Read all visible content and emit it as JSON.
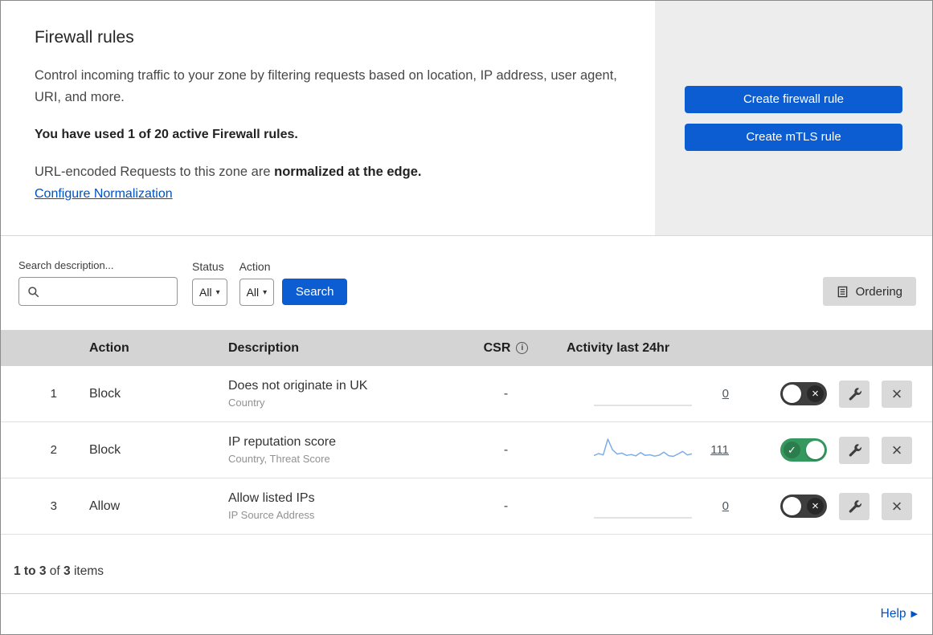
{
  "header": {
    "title": "Firewall rules",
    "description": "Control incoming traffic to your zone by filtering requests based on location, IP address, user agent, URI, and more.",
    "usage": "You have used 1 of 20 active Firewall rules.",
    "normalization_prefix": "URL-encoded Requests to this zone are",
    "normalization_bold": "normalized at the edge.",
    "normalization_link": "Configure Normalization",
    "buttons": {
      "create_firewall": "Create firewall rule",
      "create_mtls": "Create mTLS rule"
    }
  },
  "filters": {
    "search_label": "Search description...",
    "status_label": "Status",
    "status_value": "All",
    "action_label": "Action",
    "action_value": "All",
    "search_button": "Search",
    "ordering_button": "Ordering"
  },
  "table": {
    "columns": {
      "action": "Action",
      "description": "Description",
      "csr": "CSR",
      "activity": "Activity last 24hr"
    },
    "rows": [
      {
        "index": "1",
        "action": "Block",
        "description": "Does not originate in UK",
        "fields": "Country",
        "csr": "-",
        "activity": "0",
        "enabled": false,
        "sparkline": []
      },
      {
        "index": "2",
        "action": "Block",
        "description": "IP reputation score",
        "fields": "Country, Threat Score",
        "csr": "-",
        "activity": "111",
        "enabled": true,
        "sparkline": [
          2.5,
          3.4,
          2.8,
          9.5,
          5,
          3.2,
          3.6,
          2.6,
          3,
          2.4,
          3.8,
          2.6,
          2.9,
          2.3,
          2.7,
          4,
          2.5,
          2.2,
          3.2,
          4.3,
          2.8,
          3.3
        ]
      },
      {
        "index": "3",
        "action": "Allow",
        "description": "Allow listed IPs",
        "fields": "IP Source Address",
        "csr": "-",
        "activity": "0",
        "enabled": false,
        "sparkline": []
      }
    ]
  },
  "footer": {
    "range": "1 to 3",
    "of_label": "of",
    "total": "3",
    "items_label": "items",
    "help": "Help"
  },
  "icons": {
    "check": "✓",
    "cross": "×",
    "caret": "▾",
    "help_arrow": "▶",
    "info": "i"
  },
  "colors": {
    "accent_blue": "#0d5dd2",
    "link_blue": "#0051c3",
    "toggle_green": "#35995f",
    "toggle_off_gray": "#3e3e3e",
    "sparkline_blue": "#7dade8",
    "table_header_gray": "#d4d4d4",
    "panel_gray": "#ededed"
  }
}
